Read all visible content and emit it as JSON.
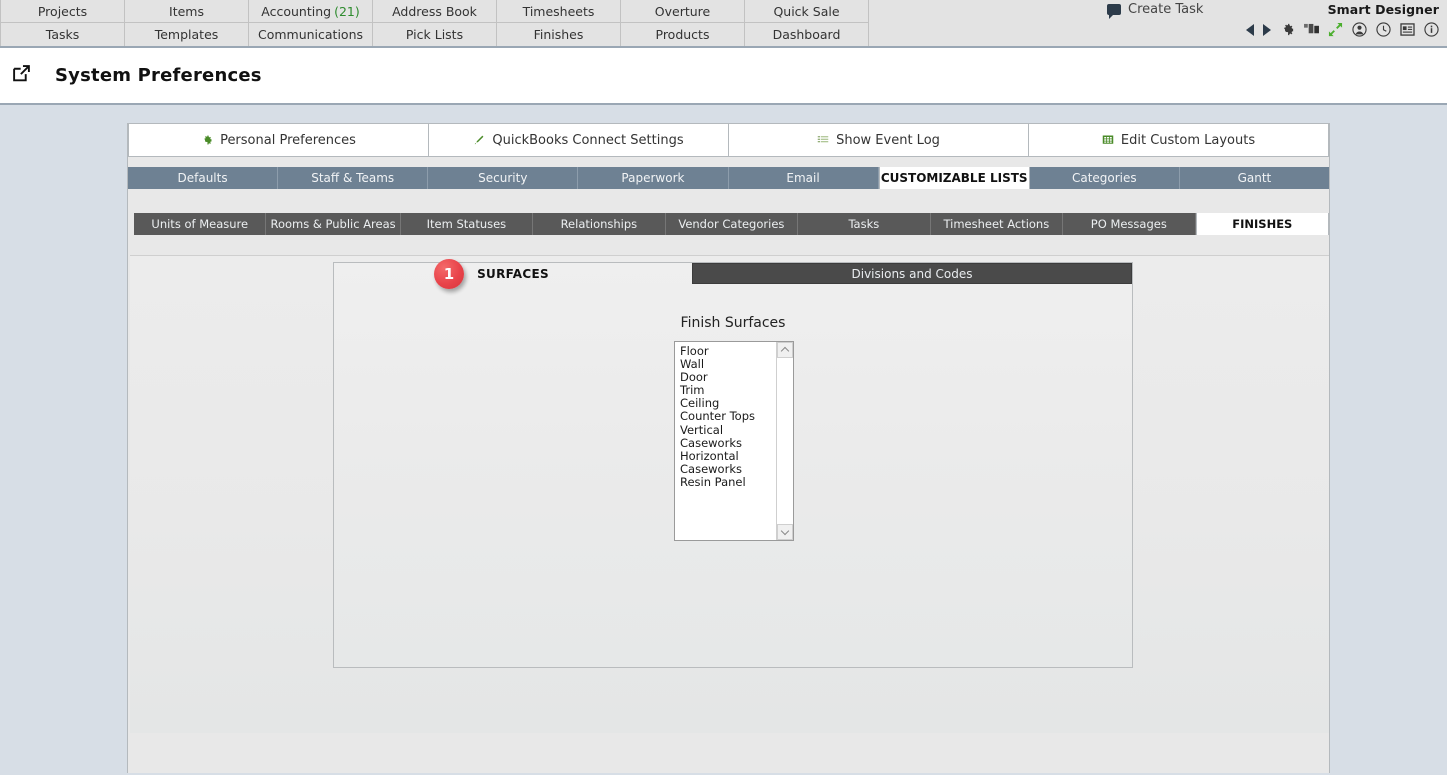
{
  "topnav": {
    "row1": [
      {
        "label": "Projects",
        "count": ""
      },
      {
        "label": "Items",
        "count": ""
      },
      {
        "label": "Accounting",
        "count": "(21)"
      },
      {
        "label": "Address Book",
        "count": ""
      },
      {
        "label": "Timesheets",
        "count": ""
      },
      {
        "label": "Overture",
        "count": ""
      },
      {
        "label": "Quick Sale",
        "count": ""
      }
    ],
    "row2": [
      {
        "label": "Tasks",
        "count": ""
      },
      {
        "label": "Templates",
        "count": ""
      },
      {
        "label": "Communications",
        "count": ""
      },
      {
        "label": "Pick Lists",
        "count": ""
      },
      {
        "label": "Finishes",
        "count": ""
      },
      {
        "label": "Products",
        "count": ""
      },
      {
        "label": "Dashboard",
        "count": ""
      }
    ],
    "create_task": "Create Task",
    "brand": "Smart Designer",
    "icons": [
      "nav-back-icon",
      "nav-forward-icon",
      "gear-icon",
      "windows-icon",
      "expand-icon",
      "user-icon",
      "clock-icon",
      "card-icon",
      "info-icon"
    ]
  },
  "title": {
    "text": "System Preferences",
    "icon": "external-link-icon"
  },
  "buttons": [
    {
      "label": "Personal Preferences",
      "icon": "gear-icon"
    },
    {
      "label": "QuickBooks Connect Settings",
      "icon": "quickbooks-icon"
    },
    {
      "label": "Show Event Log",
      "icon": "list-icon"
    },
    {
      "label": "Edit Custom Layouts",
      "icon": "grid-icon"
    }
  ],
  "tabs_level2": [
    {
      "label": "Defaults",
      "active": false
    },
    {
      "label": "Staff & Teams",
      "active": false
    },
    {
      "label": "Security",
      "active": false
    },
    {
      "label": "Paperwork",
      "active": false
    },
    {
      "label": "Email",
      "active": false
    },
    {
      "label": "CUSTOMIZABLE LISTS",
      "active": true
    },
    {
      "label": "Categories",
      "active": false
    },
    {
      "label": "Gantt",
      "active": false
    }
  ],
  "tabs_level3": [
    {
      "label": "Units of Measure",
      "active": false
    },
    {
      "label": "Rooms & Public Areas",
      "active": false
    },
    {
      "label": "Item Statuses",
      "active": false
    },
    {
      "label": "Relationships",
      "active": false
    },
    {
      "label": "Vendor Categories",
      "active": false
    },
    {
      "label": "Tasks",
      "active": false
    },
    {
      "label": "Timesheet Actions",
      "active": false
    },
    {
      "label": "PO Messages",
      "active": false
    },
    {
      "label": "FINISHES",
      "active": true
    }
  ],
  "tabs_level4": [
    {
      "label": "SURFACES",
      "active": true
    },
    {
      "label": "Divisions and Codes",
      "active": false
    }
  ],
  "badge": {
    "number": "1",
    "color": "#e8434a"
  },
  "panel": {
    "list_label": "Finish Surfaces",
    "list_items": [
      "Floor",
      "Wall",
      "Door",
      "Trim",
      "Ceiling",
      "Counter Tops",
      "Vertical",
      "Caseworks",
      "Horizontal",
      "Caseworks",
      "Resin Panel"
    ]
  },
  "colors": {
    "page_bg": "#d7dee6",
    "tabs2_bg": "#6e8193",
    "tabs3_bg": "#595959",
    "tab4_inactive_bg": "#4a4a4a",
    "accent_green": "#2e8b2e",
    "badge_red": "#e8434a"
  }
}
